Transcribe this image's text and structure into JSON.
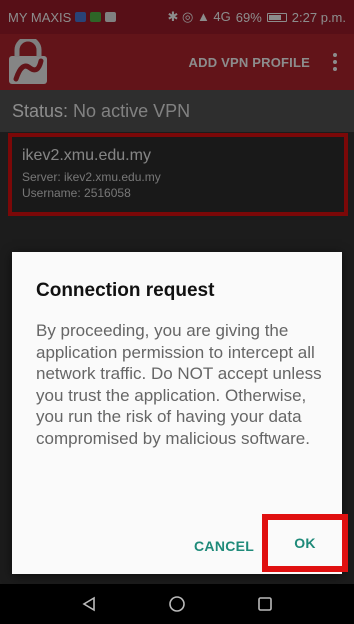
{
  "status_bar": {
    "carrier": "MY MAXIS",
    "right_info": "✱ ◎ ▲ 4G",
    "battery": "69%",
    "time": "2:27 p.m."
  },
  "app_bar": {
    "logo": "vpn-lock-logo",
    "add_vpn_label": "ADD VPN PROFILE",
    "menu_icon": "overflow-menu-icon"
  },
  "main": {
    "status_label": "Status:",
    "status_value": "No active VPN",
    "profile": {
      "name": "ikev2.xmu.edu.my",
      "server": "Server: ikev2.xmu.edu.my",
      "username": "Username: 2516058"
    }
  },
  "dialog": {
    "title": "Connection request",
    "body": "By proceeding, you are giving the application permission to intercept all network traffic. Do NOT accept unless you trust the application. Otherwise, you run the risk of having your data compromised by malicious software.",
    "cancel_label": "CANCEL",
    "ok_label": "OK"
  },
  "nav_bar": {
    "back_icon": "back-triangle-icon",
    "home_icon": "home-circle-icon",
    "recents_icon": "recents-square-icon"
  },
  "colors": {
    "app_bar": "#b3262f",
    "highlight": "#e01010",
    "dialog_button": "#1e8a79"
  }
}
